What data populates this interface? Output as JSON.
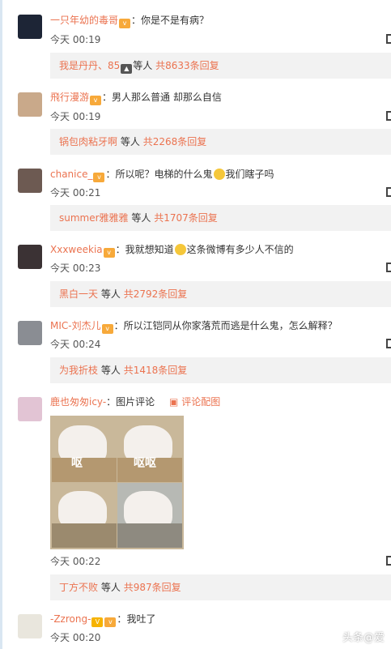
{
  "comments": [
    {
      "user": "一只年幼的毒哥",
      "text": "你是不是有病？",
      "time": "今天 00:19",
      "reply": {
        "name": "我是丹丹、85",
        "mid": "等人",
        "total": "共8633条回复"
      }
    },
    {
      "user": "飛行漫游",
      "text": "男人那么普通 却那么自信",
      "time": "今天 00:19",
      "reply": {
        "name": "锅包肉粘牙啊",
        "mid": "等人",
        "total": "共2268条回复"
      }
    },
    {
      "user": "chanice_",
      "text_a": "所以呢？电梯的什么鬼",
      "text_b": "我们瞎子吗",
      "time": "今天 00:21",
      "reply": {
        "name": "summer雅雅雅",
        "mid": "等人",
        "total": "共1707条回复"
      }
    },
    {
      "user": "Xxxweekia",
      "text_a": "我就想知道",
      "text_b": "这条微博有多少人不信的",
      "time": "今天 00:23",
      "reply": {
        "name": "黑白一天",
        "mid": "等人",
        "total": "共2792条回复"
      }
    },
    {
      "user": "MIC-刘杰儿",
      "text": "所以江铠同从你家落荒而逃是什么鬼，怎么解释？",
      "time": "今天 00:24",
      "reply": {
        "name": "为我折枝",
        "mid": "等人",
        "total": "共1418条回复"
      }
    },
    {
      "user": "鹿也匆匆icy-",
      "text": "图片评论",
      "pic_link": "评论配图",
      "time": "今天 00:22",
      "image_text": [
        "呕",
        "呕呕"
      ],
      "reply": {
        "name": "丁方不败",
        "mid": "等人",
        "total": "共987条回复"
      }
    },
    {
      "user": "-Zzrong-",
      "text": "我吐了",
      "time": "今天 00:20"
    }
  ],
  "watermark": "头条@爱",
  "colors": {
    "link": "#eb7350",
    "reply_bg": "#f2f2f2"
  }
}
